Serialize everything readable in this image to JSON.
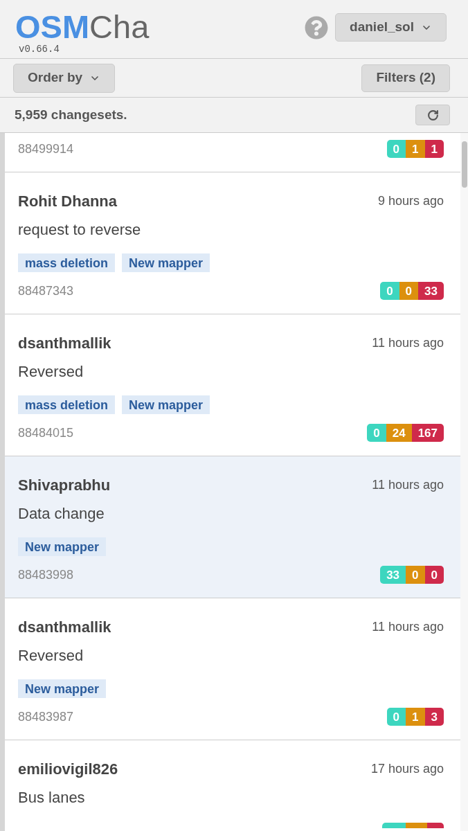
{
  "header": {
    "logo": {
      "primary": "OSM",
      "secondary": "Cha"
    },
    "version": "v0.66.4",
    "user_menu": "daniel_sol"
  },
  "toolbar": {
    "order_by": "Order by",
    "filters": "Filters (2)"
  },
  "summary": {
    "count": "5,959 changesets."
  },
  "changesets": [
    {
      "id": "88499914",
      "selected": false,
      "counts": [
        {
          "kind": "create",
          "value": "0"
        },
        {
          "kind": "modify",
          "value": "1"
        },
        {
          "kind": "delete",
          "value": "1"
        }
      ]
    },
    {
      "user": "Rohit Dhanna",
      "time": "9 hours ago",
      "comment": "request to reverse",
      "tags": [
        "mass deletion",
        "New mapper"
      ],
      "id": "88487343",
      "selected": false,
      "counts": [
        {
          "kind": "create",
          "value": "0"
        },
        {
          "kind": "modify",
          "value": "0"
        },
        {
          "kind": "delete",
          "value": "33"
        }
      ]
    },
    {
      "user": "dsanthmallik",
      "time": "11 hours ago",
      "comment": "Reversed",
      "tags": [
        "mass deletion",
        "New mapper"
      ],
      "id": "88484015",
      "selected": false,
      "counts": [
        {
          "kind": "create",
          "value": "0"
        },
        {
          "kind": "modify",
          "value": "24"
        },
        {
          "kind": "delete",
          "value": "167"
        }
      ]
    },
    {
      "user": "Shivaprabhu",
      "time": "11 hours ago",
      "comment": "Data change",
      "tags": [
        "New mapper"
      ],
      "id": "88483998",
      "selected": true,
      "counts": [
        {
          "kind": "create",
          "value": "33"
        },
        {
          "kind": "modify",
          "value": "0"
        },
        {
          "kind": "delete",
          "value": "0"
        }
      ]
    },
    {
      "user": "dsanthmallik",
      "time": "11 hours ago",
      "comment": "Reversed",
      "tags": [
        "New mapper"
      ],
      "id": "88483987",
      "selected": false,
      "counts": [
        {
          "kind": "create",
          "value": "0"
        },
        {
          "kind": "modify",
          "value": "1"
        },
        {
          "kind": "delete",
          "value": "3"
        }
      ]
    },
    {
      "user": "emiliovigil826",
      "time": "17 hours ago",
      "comment": "Bus lanes",
      "selected": false,
      "counts_cut_off": true
    }
  ]
}
